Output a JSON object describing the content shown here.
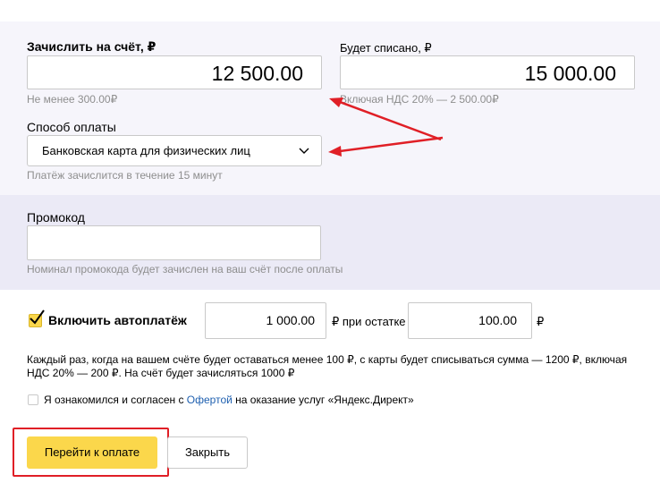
{
  "credit": {
    "label": "Зачислить на счёт, ₽",
    "value": "12 500.00",
    "hint": "Не менее 300.00₽"
  },
  "charge": {
    "label": "Будет списано, ₽",
    "value": "15 000.00",
    "hint": "Включая НДС 20% — 2 500.00₽"
  },
  "payment_method": {
    "label": "Способ оплаты",
    "selected": "Банковская карта для физических лиц",
    "hint": "Платёж зачислится в течение 15 минут"
  },
  "promo": {
    "label": "Промокод",
    "value": "",
    "hint": "Номинал промокода будет зачислен на ваш счёт после оплаты"
  },
  "autopay": {
    "checked": true,
    "label": "Включить автоплатёж",
    "amount": "1 000.00",
    "mid_text": "₽ при остатке",
    "threshold": "100.00",
    "currency": "₽",
    "description": "Каждый раз, когда на вашем счёте будет оставаться менее 100 ₽, с карты будет списываться сумма — 1200 ₽, включая НДС 20% — 200 ₽. На счёт будет зачисляться 1000 ₽"
  },
  "agreement": {
    "checked": false,
    "text_before": "Я ознакомился и согласен с ",
    "link": "Офертой",
    "text_after": " на оказание услуг «Яндекс.Директ»"
  },
  "buttons": {
    "pay": "Перейти к оплате",
    "close": "Закрыть"
  },
  "colors": {
    "accent_yellow": "#fbd74b",
    "annotation_red": "#e01f26",
    "link_blue": "#1f60b0"
  }
}
